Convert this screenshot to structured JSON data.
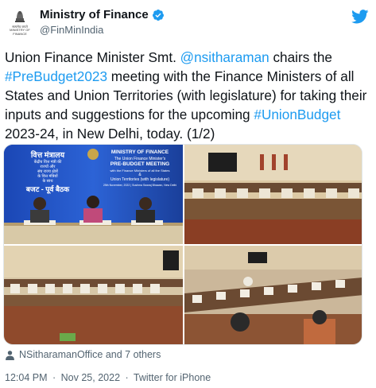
{
  "header": {
    "avatar_lines": [
      "सत्यमेव जयते",
      "MINISTRY OF",
      "FINANCE"
    ],
    "display_name": "Ministry of Finance",
    "handle": "@FinMinIndia",
    "icons": {
      "verified": "verified-badge-icon",
      "logo": "twitter-bird-icon"
    },
    "verified_color": "#1d9bf0"
  },
  "tweet": {
    "text_parts": [
      {
        "text": "Union Finance Minister Smt. ",
        "link": false
      },
      {
        "text": "@nsitharaman",
        "link": true
      },
      {
        "text": " chairs the ",
        "link": false
      },
      {
        "text": "#PreBudget2023",
        "link": true
      },
      {
        "text": " meeting with the Finance Ministers of all States and Union Territories (with legislature) for taking their inputs and suggestions for the upcoming ",
        "link": false
      },
      {
        "text": "#UnionBudget",
        "link": true
      },
      {
        "text": " 2023-24, in New Delhi, today. (1/2)",
        "link": false
      }
    ],
    "link_color": "#1d9bf0"
  },
  "media": {
    "photo1": {
      "banner_hindi": [
        "वित्त मंत्रालय",
        "केंद्रीय वित्त मंत्री की",
        "राज्यों और",
        "संघ राज्य क्षेत्रों",
        "के वित्त मंत्रियों",
        "के साथ",
        "बजट - पूर्व बैठक"
      ],
      "banner_english": [
        "MINISTRY OF FINANCE",
        "The Union Finance Minister's",
        "PRE-BUDGET MEETING",
        "with the Finance Ministers of all the States",
        "&",
        "Union Territories (with legislature)",
        "25th November, 2022 | Sushma Swaraj Bhawan, New Delhi"
      ]
    }
  },
  "tagged": {
    "text": "NSitharamanOffice and 7 others",
    "icon": "person-icon"
  },
  "footer": {
    "time": "12:04 PM",
    "date": "Nov 25, 2022",
    "source": "Twitter for iPhone",
    "separator": "·"
  }
}
